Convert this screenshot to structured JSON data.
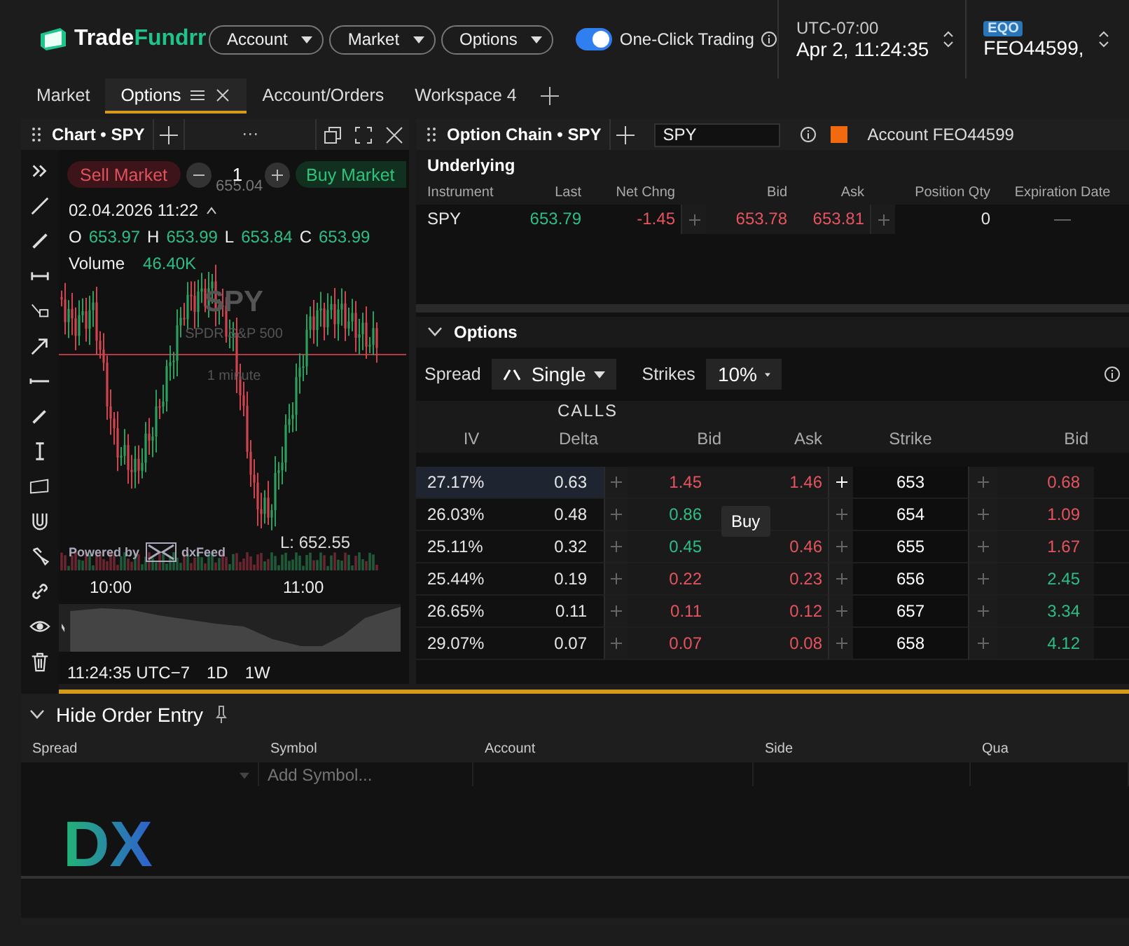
{
  "header": {
    "logo": {
      "text": "Trade",
      "accent": "Fundrr"
    },
    "menus": [
      "Account",
      "Market",
      "Options"
    ],
    "one_click": {
      "label": "One-Click Trading",
      "on": true
    },
    "clock": {
      "zone": "UTC-07:00",
      "time": "Apr 2, 11:24:35"
    },
    "account": {
      "badge": "EQO",
      "id": "FEO44599,"
    }
  },
  "tabs": [
    {
      "label": "Market",
      "selected": false
    },
    {
      "label": "Options",
      "selected": true
    },
    {
      "label": "Account/Orders",
      "selected": false
    },
    {
      "label": "Workspace 4",
      "selected": false
    }
  ],
  "chart_panel": {
    "title": "Chart • SPY",
    "more": "···",
    "order_bar": {
      "sell": "Sell Market",
      "quantity": "1",
      "buy": "Buy Market"
    },
    "price_label": "655.04",
    "date": "02.04.2026 11:22",
    "ohlc": [
      {
        "label": "O",
        "value": "653.97"
      },
      {
        "label": "H",
        "value": "653.99"
      },
      {
        "label": "L",
        "value": "653.84"
      },
      {
        "label": "C",
        "value": "653.99"
      }
    ],
    "volume": {
      "label": "Volume",
      "value": "46.40K"
    },
    "watermark": {
      "symbol": "SPY",
      "name": "SPDR S&P 500",
      "interval": "1 minute"
    },
    "low_label": "L: 652.55",
    "powered_by": "Powered by",
    "feed": "dxFeed",
    "time_axis": [
      "10:00",
      "11:00"
    ],
    "footer": {
      "time": "11:24:35 UTC−7",
      "ranges": [
        "1D",
        "1W"
      ]
    }
  },
  "option_chain": {
    "title": "Option Chain • SPY",
    "symbol": "SPY",
    "account": "Account FEO44599",
    "underlying": {
      "title": "Underlying",
      "columns": [
        "Instrument",
        "Last",
        "Net Chng",
        "Bid",
        "Ask",
        "Position Qty",
        "Expiration Date"
      ],
      "row": {
        "instrument": "SPY",
        "last": {
          "text": "653.79",
          "rising": true
        },
        "net_chng": {
          "text": "-1.45",
          "rising": false
        },
        "bid": {
          "text": "653.78",
          "rising": false
        },
        "ask": {
          "text": "653.81",
          "rising": false
        },
        "position_qty": "0",
        "expiration_date": "—"
      }
    },
    "options": {
      "title": "Options",
      "spread_label": "Spread",
      "spread_value": "Single",
      "strikes_label": "Strikes",
      "strikes_value": "10%",
      "calls_label": "CALLS",
      "columns": [
        "IV",
        "Delta",
        "Bid",
        "Ask",
        "Strike",
        "Bid"
      ],
      "rows": [
        {
          "iv": "27.17%",
          "delta": "0.63",
          "call_bid": {
            "text": "1.45",
            "rising": false
          },
          "call_ask": {
            "text": "1.46",
            "rising": false
          },
          "strike": "653",
          "put_bid": {
            "text": "0.68",
            "rising": false
          },
          "selected": true
        },
        {
          "iv": "26.03%",
          "delta": "0.48",
          "call_bid": {
            "text": "0.86",
            "rising": true
          },
          "call_ask": null,
          "strike": "654",
          "put_bid": {
            "text": "1.09",
            "rising": false
          },
          "selected": false
        },
        {
          "iv": "25.11%",
          "delta": "0.32",
          "call_bid": {
            "text": "0.45",
            "rising": true
          },
          "call_ask": {
            "text": "0.46",
            "rising": false
          },
          "strike": "655",
          "put_bid": {
            "text": "1.67",
            "rising": false
          },
          "selected": false
        },
        {
          "iv": "25.44%",
          "delta": "0.19",
          "call_bid": {
            "text": "0.22",
            "rising": false
          },
          "call_ask": {
            "text": "0.23",
            "rising": false
          },
          "strike": "656",
          "put_bid": {
            "text": "2.45",
            "rising": true
          },
          "selected": false
        },
        {
          "iv": "26.65%",
          "delta": "0.11",
          "call_bid": {
            "text": "0.11",
            "rising": false
          },
          "call_ask": {
            "text": "0.12",
            "rising": false
          },
          "strike": "657",
          "put_bid": {
            "text": "3.34",
            "rising": true
          },
          "selected": false
        },
        {
          "iv": "29.07%",
          "delta": "0.07",
          "call_bid": {
            "text": "0.07",
            "rising": false
          },
          "call_ask": {
            "text": "0.08",
            "rising": false
          },
          "strike": "658",
          "put_bid": {
            "text": "4.12",
            "rising": true
          },
          "selected": false
        }
      ],
      "tooltip": "Buy"
    }
  },
  "order_entry": {
    "title": "Hide Order Entry",
    "columns": [
      "Spread",
      "Symbol",
      "Account",
      "Side",
      "Qua"
    ],
    "symbol_placeholder": "Add Symbol...",
    "logo": "DX"
  }
}
